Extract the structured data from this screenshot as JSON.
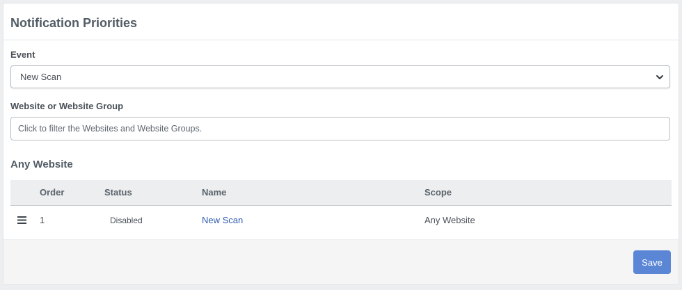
{
  "header": {
    "title": "Notification Priorities"
  },
  "form": {
    "event_label": "Event",
    "event_value": "New Scan",
    "website_label": "Website or Website Group",
    "website_placeholder": "Click to filter the Websites and Website Groups."
  },
  "section": {
    "title": "Any Website"
  },
  "table": {
    "columns": [
      "",
      "Order",
      "Status",
      "Name",
      "Scope"
    ],
    "rows": [
      {
        "order": "1",
        "status": "Disabled",
        "name": "New Scan",
        "scope": "Any Website"
      }
    ]
  },
  "footer": {
    "save_label": "Save"
  },
  "colors": {
    "primary_button": "#5b86d6",
    "link": "#2f5bb0",
    "status_disabled": "#8a5a12"
  },
  "icons": {
    "select_arrow": "chevron-down-icon",
    "row_handle": "drag-handle-icon"
  }
}
